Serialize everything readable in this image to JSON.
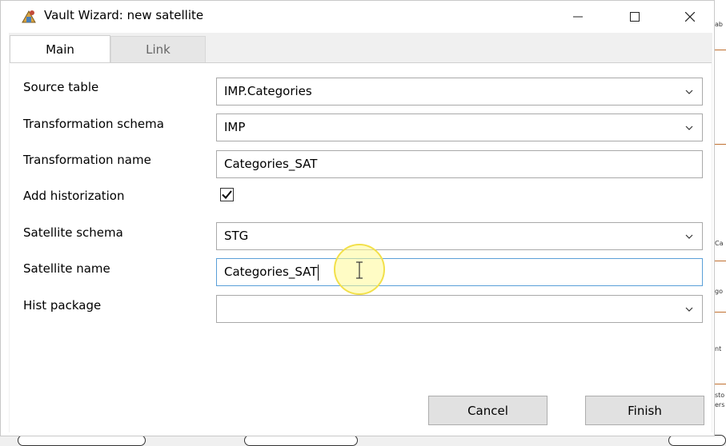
{
  "window": {
    "title": "Vault Wizard: new satellite",
    "controls": {
      "minimize": "minimize-icon",
      "maximize": "maximize-icon",
      "close": "close-icon"
    }
  },
  "tabs": [
    {
      "label": "Main",
      "active": true
    },
    {
      "label": "Link",
      "active": false
    }
  ],
  "form": {
    "source_table": {
      "label": "Source table",
      "value": "IMP.Categories"
    },
    "transformation_schema": {
      "label": "Transformation schema",
      "value": "IMP"
    },
    "transformation_name": {
      "label": "Transformation name",
      "value": "Categories_SAT"
    },
    "add_historization": {
      "label": "Add historization",
      "checked": true
    },
    "satellite_schema": {
      "label": "Satellite schema",
      "value": "STG"
    },
    "satellite_name": {
      "label": "Satellite name",
      "value": "Categories_SAT"
    },
    "hist_package": {
      "label": "Hist package",
      "value": ""
    }
  },
  "buttons": {
    "cancel": "Cancel",
    "finish": "Finish"
  },
  "background_fragments": [
    "ab",
    "Ca",
    "go",
    "nt",
    "sto",
    "ers"
  ],
  "colors": {
    "focus_border": "#5a9fd8",
    "cursor_highlight": "#f2e04a"
  }
}
